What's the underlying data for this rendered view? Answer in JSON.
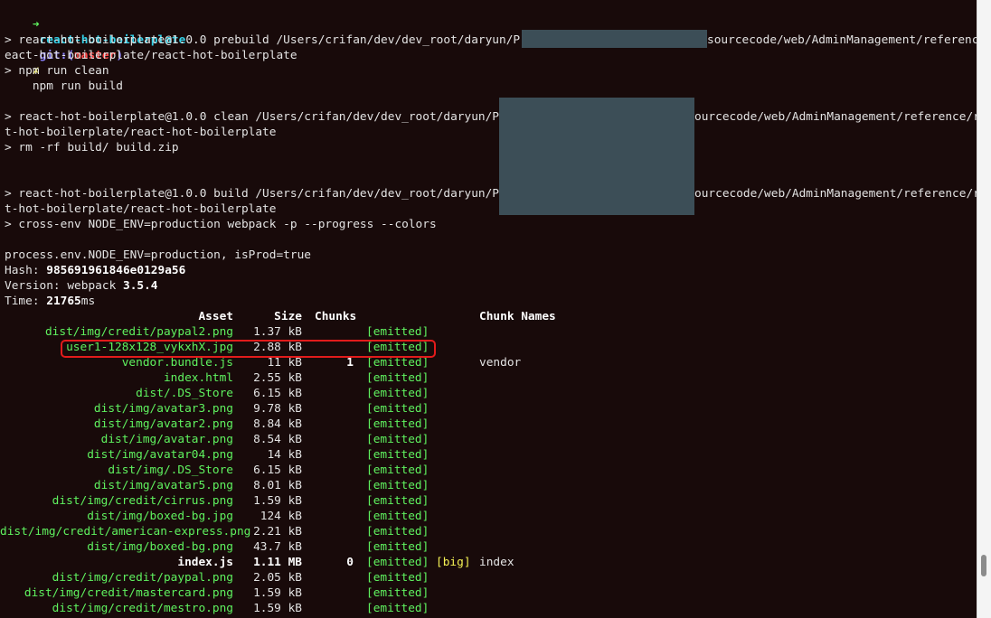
{
  "prompt": {
    "arrow": "➜",
    "dir": "react-hot-boilerplate",
    "git_label": "git:(",
    "branch": "master",
    "git_close": ")",
    "dirty": "✗",
    "command": "npm run build"
  },
  "log": {
    "prebuild_1": "> react-hot-boilerplate@1.0.0 prebuild /Users/crifan/dev/dev_root/daryun/Projects/",
    "prebuild_1b": "sourcecode/web/AdminManagement/reference/r",
    "prebuild_2": "eact-hot-boilerplate/react-hot-boilerplate",
    "prebuild_3": "> npm run clean",
    "clean_1": "> react-hot-boilerplate@1.0.0 clean /Users/crifan/dev/dev_root/daryun/Projects",
    "clean_1b": "ourcecode/web/AdminManagement/reference/reac",
    "clean_2": "t-hot-boilerplate/react-hot-boilerplate",
    "clean_3": "> rm -rf build/ build.zip",
    "build_1": "> react-hot-boilerplate@1.0.0 build /Users/crifan/dev/dev_root/daryun/Projects",
    "build_1b": "ourcecode/web/AdminManagement/reference/reac",
    "build_2": "t-hot-boilerplate/react-hot-boilerplate",
    "build_3": "> cross-env NODE_ENV=production webpack -p --progress --colors",
    "env": "process.env.NODE_ENV=production, isProd=true",
    "hash_label": "Hash: ",
    "hash": "985691961846e0129a56",
    "version_label": "Version: webpack ",
    "version": "3.5.4",
    "time_label": "Time: ",
    "time_value": "21765",
    "time_unit": "ms"
  },
  "table": {
    "headers": {
      "asset": "Asset",
      "size": "Size",
      "chunks": "Chunks",
      "chunk_names": "Chunk Names"
    },
    "rows": [
      {
        "asset": "dist/img/credit/paypal2.png",
        "size": "1.37 kB",
        "chunk": "",
        "status": "[emitted]",
        "flag": "",
        "name": ""
      },
      {
        "asset": "user1-128x128_vykxhX.jpg",
        "size": "2.88 kB",
        "chunk": "",
        "status": "[emitted]",
        "flag": "",
        "name": ""
      },
      {
        "asset": "vendor.bundle.js",
        "size": "11 kB",
        "chunk": "1",
        "status": "[emitted]",
        "flag": "",
        "name": "vendor"
      },
      {
        "asset": "index.html",
        "size": "2.55 kB",
        "chunk": "",
        "status": "[emitted]",
        "flag": "",
        "name": ""
      },
      {
        "asset": "dist/.DS_Store",
        "size": "6.15 kB",
        "chunk": "",
        "status": "[emitted]",
        "flag": "",
        "name": ""
      },
      {
        "asset": "dist/img/avatar3.png",
        "size": "9.78 kB",
        "chunk": "",
        "status": "[emitted]",
        "flag": "",
        "name": ""
      },
      {
        "asset": "dist/img/avatar2.png",
        "size": "8.84 kB",
        "chunk": "",
        "status": "[emitted]",
        "flag": "",
        "name": ""
      },
      {
        "asset": "dist/img/avatar.png",
        "size": "8.54 kB",
        "chunk": "",
        "status": "[emitted]",
        "flag": "",
        "name": ""
      },
      {
        "asset": "dist/img/avatar04.png",
        "size": "14 kB",
        "chunk": "",
        "status": "[emitted]",
        "flag": "",
        "name": ""
      },
      {
        "asset": "dist/img/.DS_Store",
        "size": "6.15 kB",
        "chunk": "",
        "status": "[emitted]",
        "flag": "",
        "name": ""
      },
      {
        "asset": "dist/img/avatar5.png",
        "size": "8.01 kB",
        "chunk": "",
        "status": "[emitted]",
        "flag": "",
        "name": ""
      },
      {
        "asset": "dist/img/credit/cirrus.png",
        "size": "1.59 kB",
        "chunk": "",
        "status": "[emitted]",
        "flag": "",
        "name": ""
      },
      {
        "asset": "dist/img/boxed-bg.jpg",
        "size": "124 kB",
        "chunk": "",
        "status": "[emitted]",
        "flag": "",
        "name": ""
      },
      {
        "asset": "dist/img/credit/american-express.png",
        "size": "2.21 kB",
        "chunk": "",
        "status": "[emitted]",
        "flag": "",
        "name": ""
      },
      {
        "asset": "dist/img/boxed-bg.png",
        "size": "43.7 kB",
        "chunk": "",
        "status": "[emitted]",
        "flag": "",
        "name": ""
      },
      {
        "asset": "index.js",
        "size": "1.11 MB",
        "chunk": "0",
        "status": "[emitted]",
        "flag": "[big]",
        "name": "index",
        "big": true
      },
      {
        "asset": "dist/img/credit/paypal.png",
        "size": "2.05 kB",
        "chunk": "",
        "status": "[emitted]",
        "flag": "",
        "name": ""
      },
      {
        "asset": "dist/img/credit/mastercard.png",
        "size": "1.59 kB",
        "chunk": "",
        "status": "[emitted]",
        "flag": "",
        "name": ""
      },
      {
        "asset": "dist/img/credit/mestro.png",
        "size": "1.59 kB",
        "chunk": "",
        "status": "[emitted]",
        "flag": "",
        "name": ""
      }
    ]
  },
  "colors": {
    "background": "#180a0a",
    "text": "#e3e3e3",
    "asset_green": "#5ff25f",
    "big_yellow": "#f4f154",
    "redaction": "#3c4e57",
    "highlight_red": "#e21b1b"
  }
}
